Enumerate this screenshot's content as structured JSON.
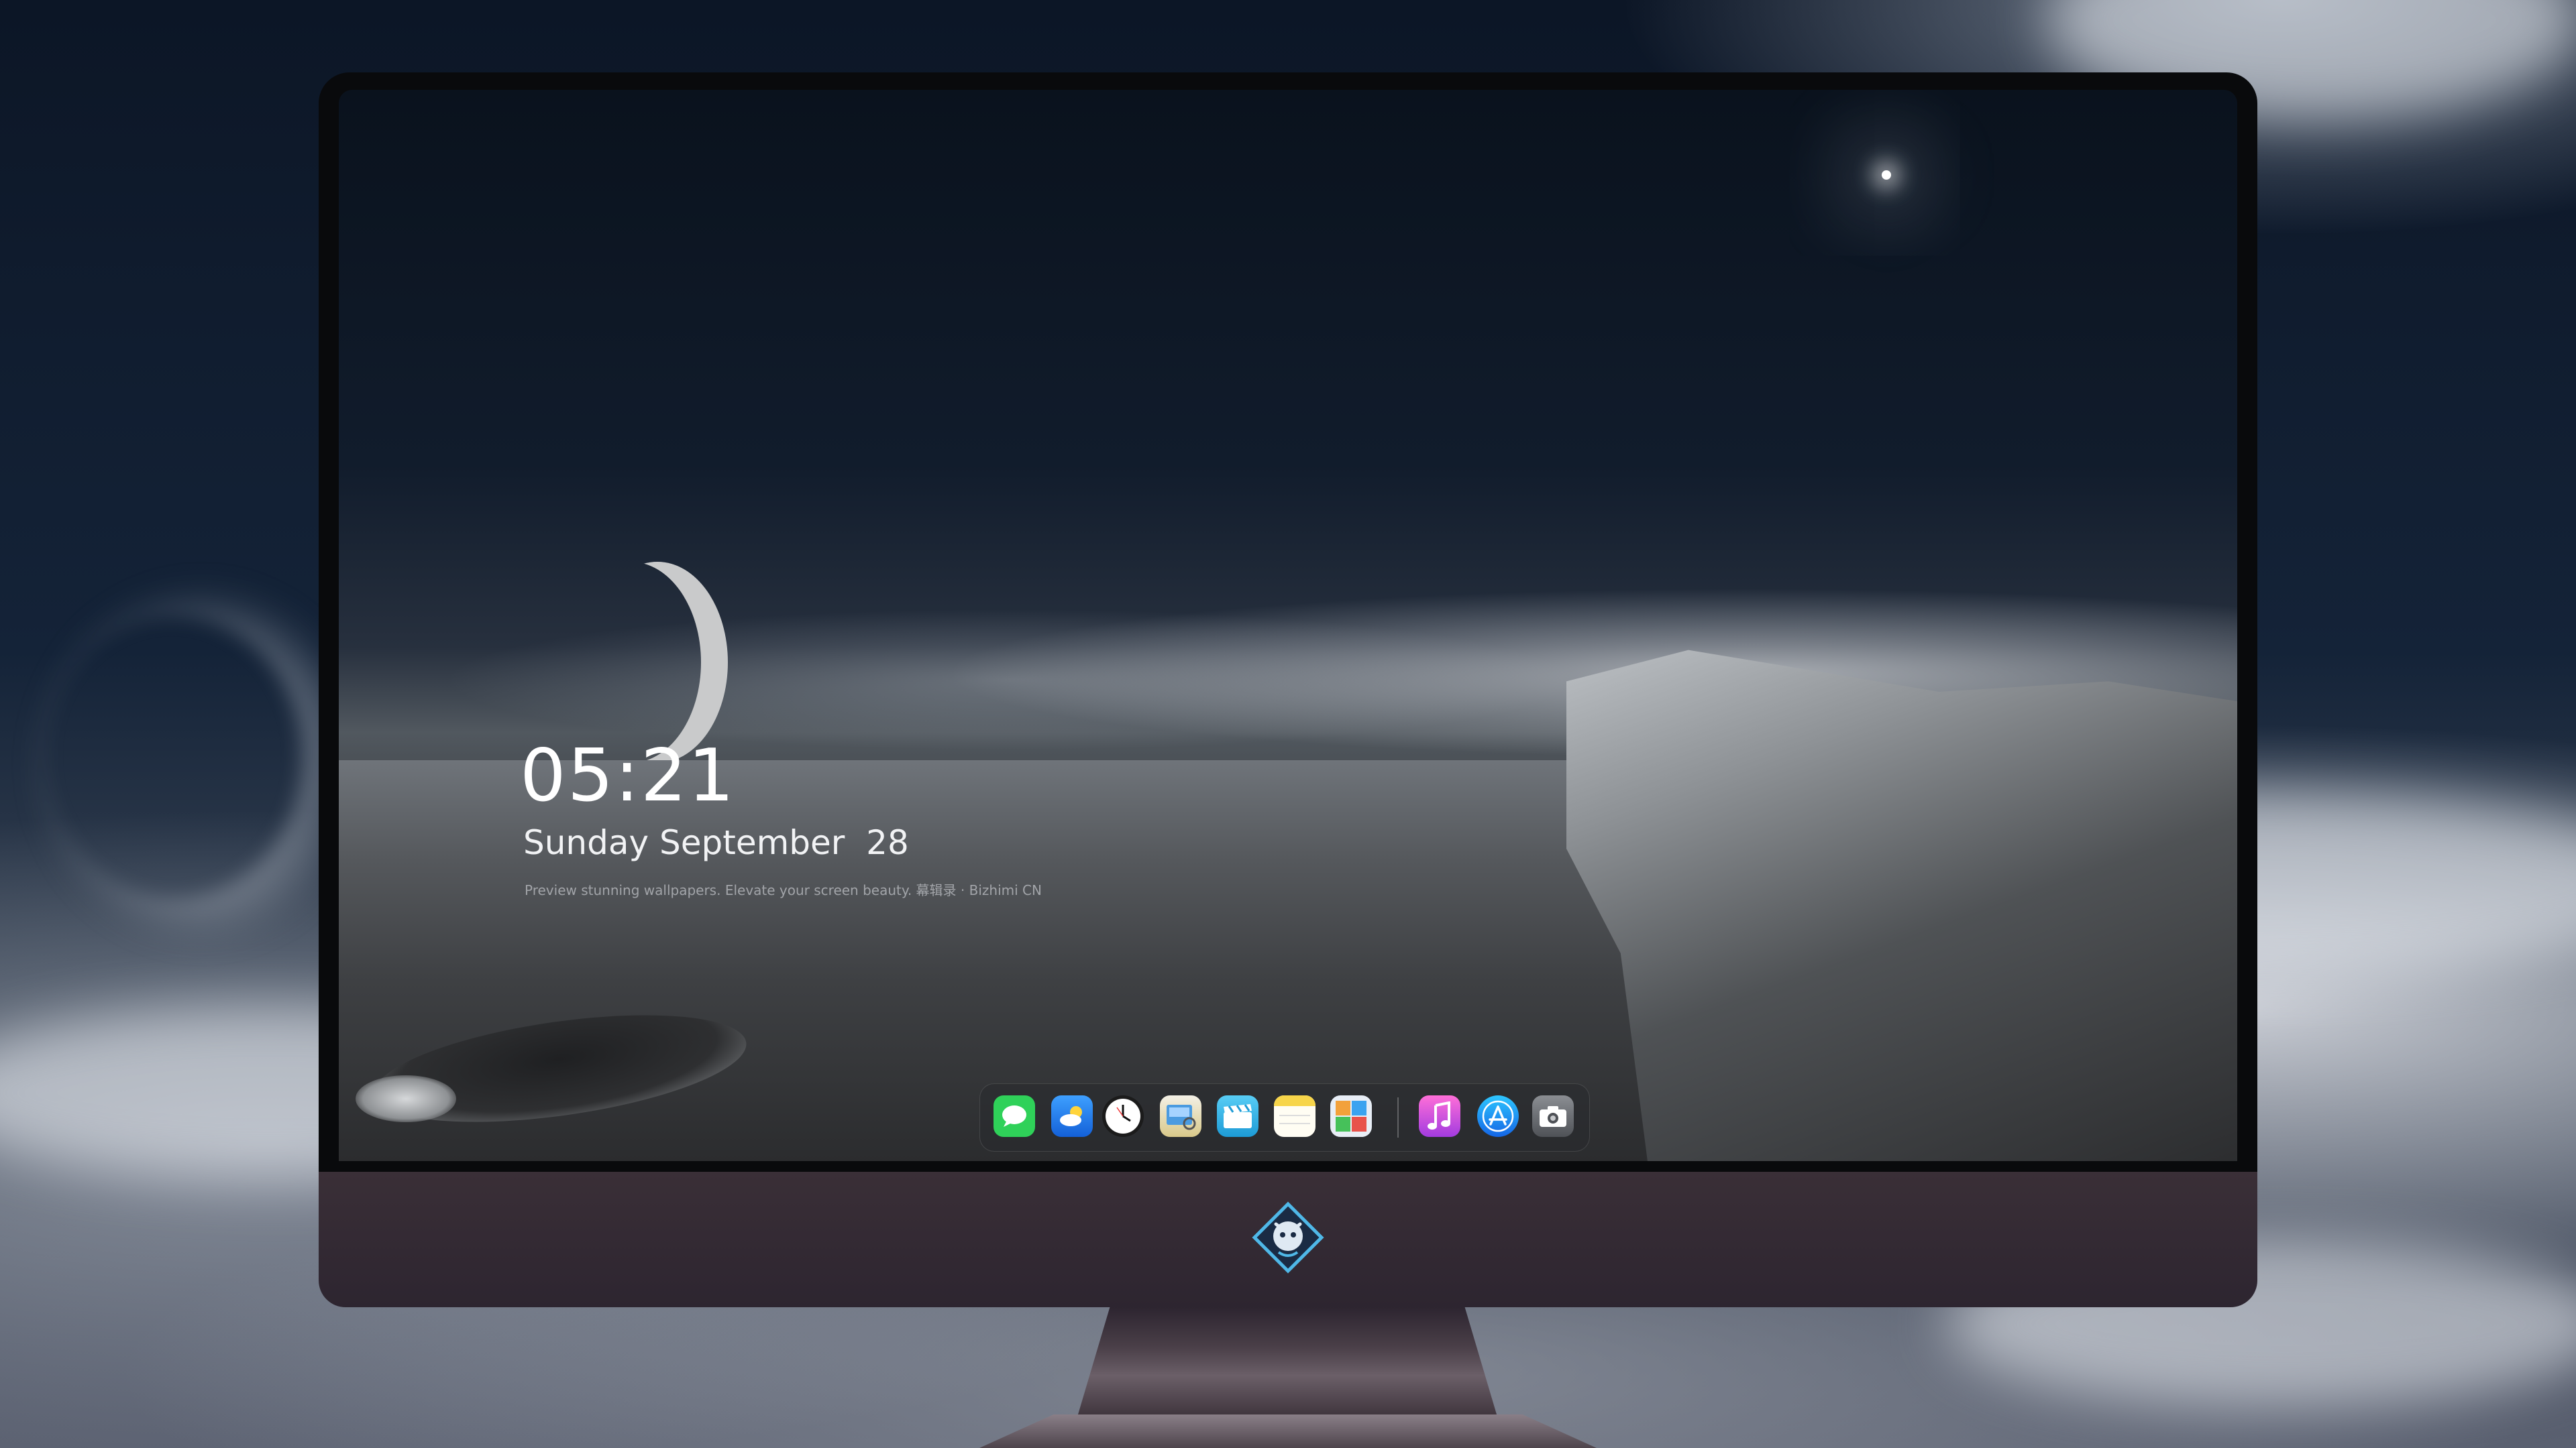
{
  "lock_screen": {
    "time": "05:21",
    "date": "Sunday September  28",
    "tagline": "Preview stunning wallpapers. Elevate your screen beauty. 幕辑录 · Bizhimi CN"
  },
  "dock": {
    "apps": [
      {
        "name": "Messages",
        "icon": "messages-icon",
        "color": "#2fd159"
      },
      {
        "name": "Weather",
        "icon": "weather-icon",
        "color": "#1e7bf0"
      },
      {
        "name": "Clock",
        "icon": "clock-icon",
        "color": "#1b1b1b"
      },
      {
        "name": "Preview",
        "icon": "preview-icon",
        "color": "#e9c35a"
      },
      {
        "name": "Clips",
        "icon": "clips-icon",
        "color": "#35b6e8"
      },
      {
        "name": "Notes",
        "icon": "notes-icon",
        "color": "#f7d54a"
      },
      {
        "name": "Photo Booth",
        "icon": "photo-booth-icon",
        "color": "#6a9bd8"
      },
      {
        "name": "Music",
        "icon": "music-icon",
        "color": "#c04bd8"
      },
      {
        "name": "App Store",
        "icon": "app-store-icon",
        "color": "#1f8ef1"
      },
      {
        "name": "Screenshot",
        "icon": "camera-icon",
        "color": "#5a5d62"
      }
    ]
  },
  "colors": {
    "monitor_chin": "#3a2f37",
    "bezel": "#090a0c"
  }
}
